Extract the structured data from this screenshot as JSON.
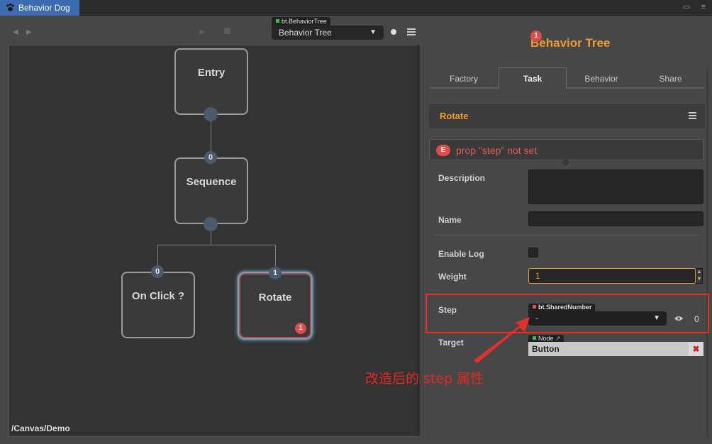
{
  "window": {
    "tab_title": "Behavior Dog",
    "colors": {
      "accent_tab": "#3c6bb0",
      "title_orange": "#f29a2e",
      "error_red": "#e04b4b",
      "annotation_red": "#e4302a"
    }
  },
  "toolbar": {
    "tree_type_tag": "bt.BehaviorTree",
    "tree_select_value": "Behavior Tree"
  },
  "canvas": {
    "path": "/Canvas/Demo",
    "nodes": {
      "entry": {
        "label": "Entry"
      },
      "sequence": {
        "label": "Sequence",
        "index": "0"
      },
      "on_click": {
        "label": "On Click ?",
        "index": "0"
      },
      "rotate": {
        "label": "Rotate",
        "index": "1",
        "error_count": "1"
      }
    }
  },
  "inspector": {
    "title": "Behavior Tree",
    "error_count": "1",
    "tabs": [
      "Factory",
      "Task",
      "Behavior",
      "Share"
    ],
    "active_tab": "Task",
    "section_title": "Rotate",
    "error": {
      "badge": "E",
      "message": "prop \"step\" not set"
    },
    "props": {
      "description_label": "Description",
      "description_value": "",
      "name_label": "Name",
      "name_value": "",
      "enable_log_label": "Enable Log",
      "weight_label": "Weight",
      "weight_value": "1",
      "step_label": "Step",
      "step_type_tag": "bt.SharedNumber",
      "step_value": "-",
      "step_count": "0",
      "target_label": "Target",
      "target_type_tag": "Node",
      "target_value": "Button"
    }
  },
  "annotation": {
    "text": "改造后的 step 属性"
  }
}
